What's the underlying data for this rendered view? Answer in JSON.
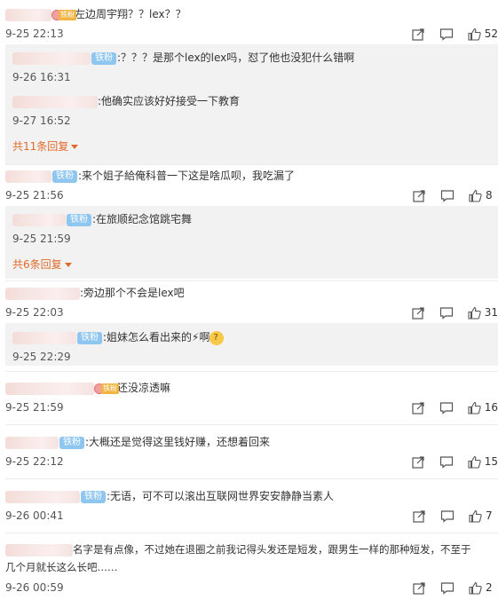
{
  "comments": [
    {
      "text": ":左边周宇翔？？lex？？",
      "badge_medal": "铁粉",
      "time": "9-25 22:13",
      "likes": "52",
      "replies": [
        {
          "badge": "铁粉",
          "text": ":？？？是那个lex的lex吗，怼了他也没犯什么错啊",
          "time": "9-26 16:31"
        },
        {
          "badge": "",
          "text": ":他确实应该好好接受一下教育",
          "time": "9-27 16:52"
        }
      ],
      "more": "共11条回复"
    },
    {
      "badge": "铁粉",
      "text": ":来个姐子給俺科普一下这是啥瓜呗，我吃漏了",
      "time": "9-25 21:56",
      "likes": "8",
      "replies": [
        {
          "badge": "铁粉",
          "text": ":在旅顺纪念馆跳宅舞",
          "time": "9-25 21:59"
        }
      ],
      "more": "共6条回复"
    },
    {
      "text": ":旁边那个不会是lex吧",
      "time": "9-25 22:03",
      "likes": "31",
      "replies": [
        {
          "badge": "铁粉",
          "text": ":姐妹怎么看出来的⚡啊",
          "time": "9-25 22:29"
        }
      ]
    },
    {
      "badge_medal": "铁粉",
      "text": ":还没凉透嘛",
      "time": "9-25 21:59",
      "likes": "16"
    },
    {
      "badge": "铁粉",
      "text": ":大概还是觉得这里钱好赚，还想着回来",
      "time": "9-25 22:12",
      "likes": "15"
    },
    {
      "badge": "铁粉",
      "text": ":无语，可不可以滚出互联网世界安安静静当素人",
      "time": "9-26 00:41",
      "likes": "7"
    },
    {
      "text": "名字是有点像，不过她在退圈之前我记得头发还是短发，跟男生一样的那种短发，不至于",
      "text2": "几个月就长这么长吧……",
      "time": "9-26 00:59",
      "likes": "2"
    }
  ],
  "icons": [
    "share-icon",
    "comment-icon",
    "like-icon"
  ]
}
